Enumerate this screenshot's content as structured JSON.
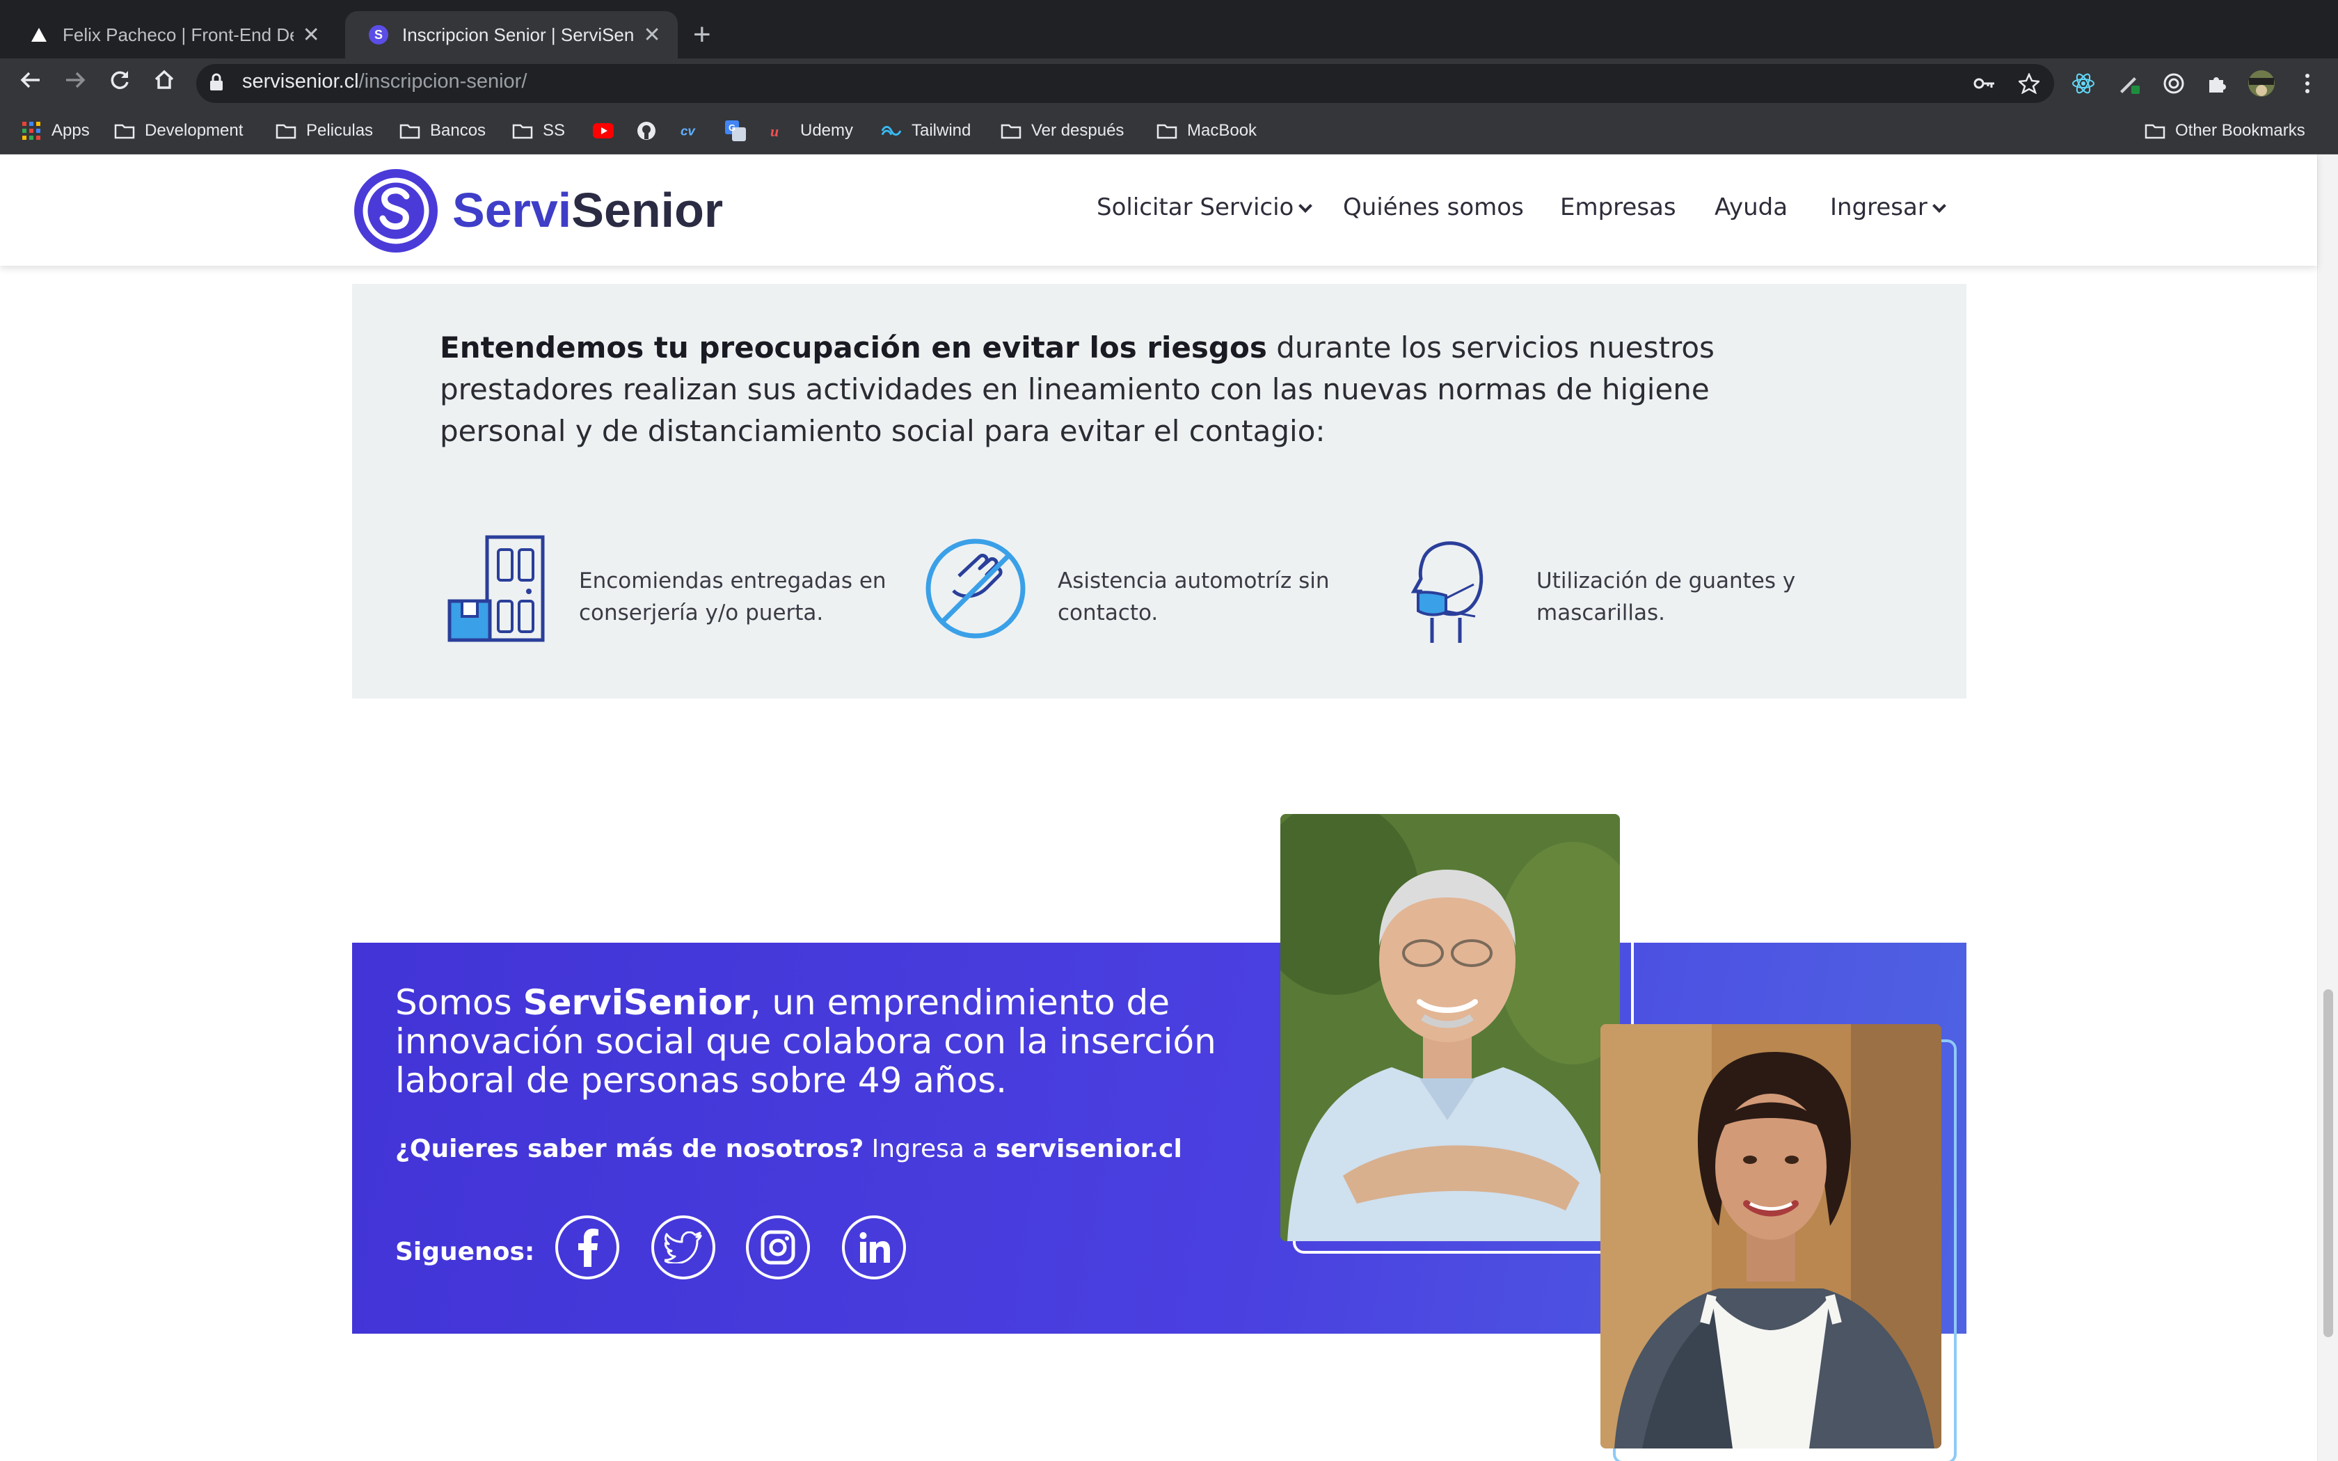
{
  "browser": {
    "tabs": [
      {
        "title": "Felix Pacheco | Front-End Deve",
        "active": false
      },
      {
        "title": "Inscripcion Senior | ServiSenior",
        "active": true
      }
    ],
    "new_tab_icon": "plus-icon",
    "url_host": "servisenior.cl",
    "url_path": "/inscripcion-senior/",
    "bookmarks": [
      {
        "label": "Apps",
        "icon": "apps-grid-icon"
      },
      {
        "label": "Development",
        "icon": "folder-icon"
      },
      {
        "label": "Peliculas",
        "icon": "folder-icon"
      },
      {
        "label": "Bancos",
        "icon": "folder-icon"
      },
      {
        "label": "SS",
        "icon": "folder-icon"
      },
      {
        "label": "",
        "icon": "youtube-icon"
      },
      {
        "label": "",
        "icon": "github-icon"
      },
      {
        "label": "",
        "icon": "cv-icon"
      },
      {
        "label": "",
        "icon": "translate-icon"
      },
      {
        "label": "Udemy",
        "icon": "udemy-icon"
      },
      {
        "label": "Tailwind",
        "icon": "tailwind-icon"
      },
      {
        "label": "Ver después",
        "icon": "folder-icon"
      },
      {
        "label": "MacBook",
        "icon": "folder-icon"
      }
    ],
    "other_bookmarks": "Other Bookmarks"
  },
  "site": {
    "brand_part1": "Servi",
    "brand_part2": "Senior",
    "nav": {
      "solicitar": "Solicitar Servicio",
      "quienes": "Quiénes somos",
      "empresas": "Empresas",
      "ayuda": "Ayuda",
      "ingresar": "Ingresar"
    }
  },
  "care": {
    "intro_bold": "Entendemos tu preocupación en evitar los riesgos",
    "intro_rest": " durante los servicios nuestros prestadores realizan sus actividades en lineamiento con las nuevas normas de higiene personal y de distanciamiento social para evitar el contagio:",
    "features": [
      {
        "icon": "door-package-icon",
        "text": "Encomiendas entregadas en conserjería y/o puerta."
      },
      {
        "icon": "no-contact-hand-icon",
        "text": "Asistencia automotríz sin contacto."
      },
      {
        "icon": "face-mask-icon",
        "text": "Utilización de guantes y mascarillas."
      }
    ]
  },
  "about": {
    "text_pre": "Somos ",
    "text_bold": "ServiSenior",
    "text_post": ", un emprendimiento de innovación social que colabora con la inserción laboral de personas sobre 49 años.",
    "more_bold": "¿Quieres saber más de nosotros?",
    "more_mid": " Ingresa a ",
    "more_link": "servisenior.cl",
    "follow": "Siguenos:",
    "social": [
      "facebook-icon",
      "twitter-icon",
      "instagram-icon",
      "linkedin-icon"
    ]
  },
  "colors": {
    "brand": "#3f3ec8",
    "panel_grey": "#eef1f2",
    "about_gradient_start": "#4234d6",
    "about_gradient_end": "#4f63e3",
    "icon_navy": "#2a3f9a",
    "icon_blue": "#3aa0e8"
  }
}
